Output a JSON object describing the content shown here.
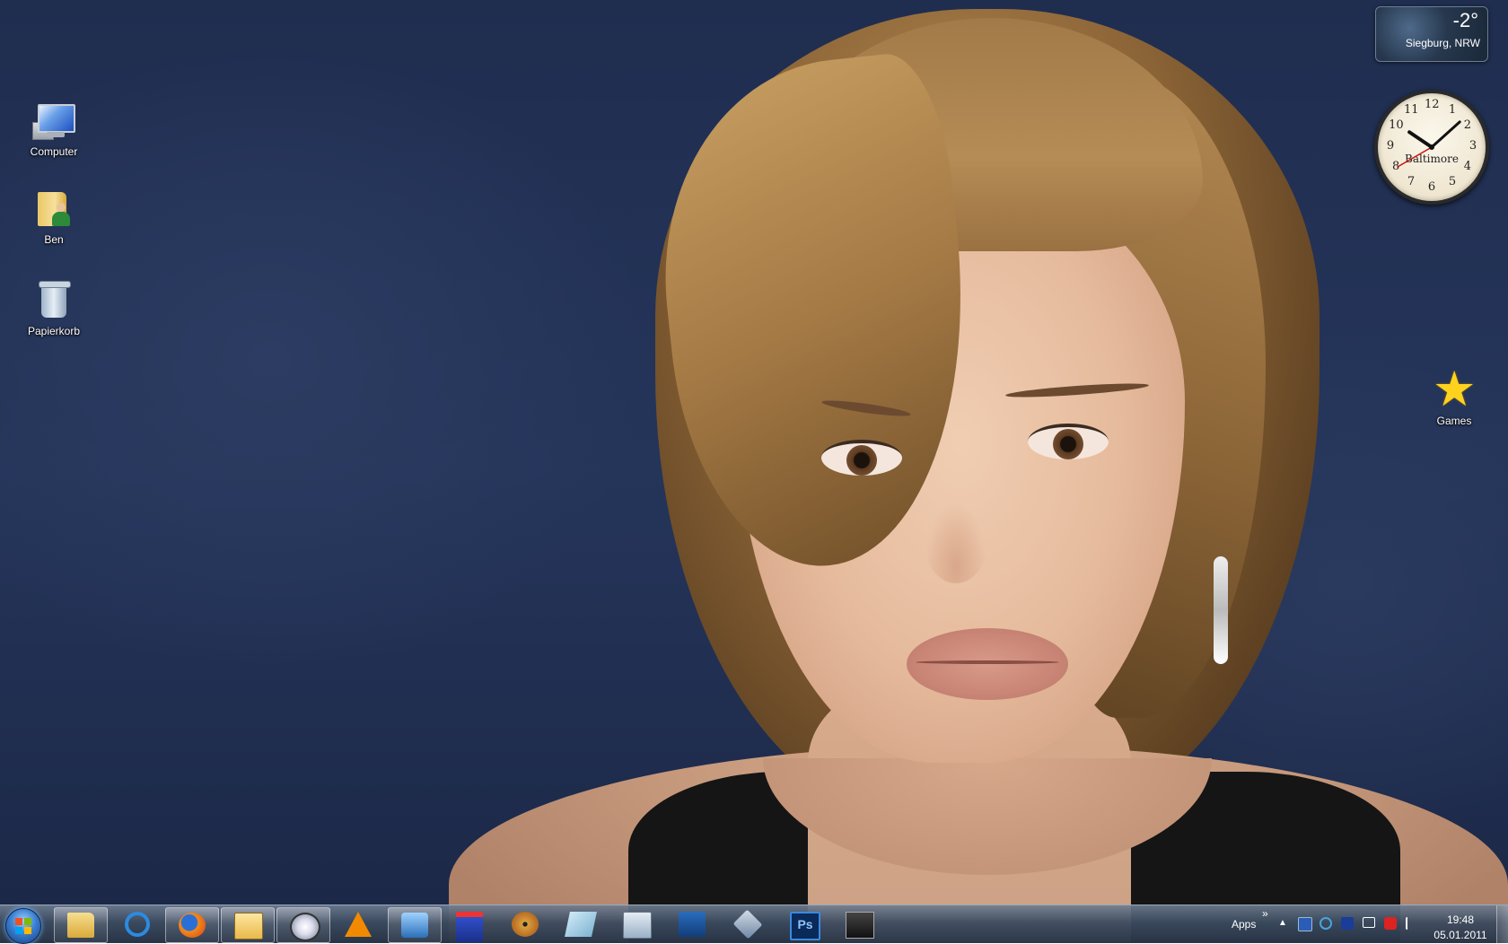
{
  "desktop": {
    "icons": [
      {
        "label": "Computer",
        "icon": "computer-icon"
      },
      {
        "label": "Ben",
        "icon": "user-folder-icon"
      },
      {
        "label": "Papierkorb",
        "icon": "recycle-bin-icon"
      },
      {
        "label": "Games",
        "icon": "games-star-icon"
      }
    ]
  },
  "gadgets": {
    "weather": {
      "temperature": "-2°",
      "location": "Siegburg, NRW"
    },
    "clock": {
      "city": "Baltimore",
      "numbers": [
        "12",
        "1",
        "2",
        "3",
        "4",
        "5",
        "6",
        "7",
        "8",
        "9",
        "10",
        "11"
      ],
      "hour": 10,
      "minute": 8
    }
  },
  "taskbar": {
    "start": {
      "icon": "windows-start-icon"
    },
    "pinned": [
      {
        "name": "windows-explorer",
        "icon": "folder-icon",
        "active": true
      },
      {
        "name": "internet-explorer",
        "icon": "ie-icon",
        "active": false
      },
      {
        "name": "firefox",
        "icon": "firefox-icon",
        "active": true
      },
      {
        "name": "mail-app",
        "icon": "mail-icon",
        "active": true
      },
      {
        "name": "network-tool",
        "icon": "network-icon",
        "active": true
      },
      {
        "name": "vlc",
        "icon": "vlc-icon",
        "active": false
      },
      {
        "name": "media-player",
        "icon": "media-player-icon",
        "active": true
      },
      {
        "name": "save-tool",
        "icon": "floppy-icon",
        "active": false
      },
      {
        "name": "disc-burner",
        "icon": "disc-icon",
        "active": false
      },
      {
        "name": "notes",
        "icon": "notes-icon",
        "active": false
      },
      {
        "name": "calculator",
        "icon": "calculator-icon",
        "active": false
      },
      {
        "name": "powershell",
        "icon": "powershell-icon",
        "active": false
      },
      {
        "name": "virtualbox",
        "icon": "virtualbox-icon",
        "active": false
      },
      {
        "name": "photoshop",
        "icon": "photoshop-icon",
        "active": false
      },
      {
        "name": "photo-app",
        "icon": "photo-icon",
        "active": false
      }
    ],
    "tray": {
      "apps_label": "Apps",
      "overflow": "»",
      "show_hidden": "▲",
      "time": "19:48",
      "date": "05.01.2011"
    }
  },
  "colors": {
    "accent": "#3b7fd0",
    "wallpaper": "#25355a"
  }
}
